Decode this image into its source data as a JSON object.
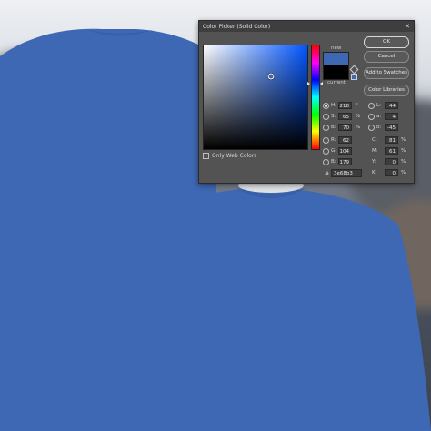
{
  "dialog": {
    "title": "Color Picker (Solid Color)",
    "close_glyph": "✕",
    "new_label": "new",
    "current_label": "current",
    "new_color": "#3e68b3",
    "current_color": "#000000",
    "hue_base_color": "#0055ff",
    "buttons": {
      "ok": "OK",
      "cancel": "Cancel",
      "add_to_swatches": "Add to Swatches",
      "color_libraries": "Color Libraries"
    },
    "only_web_colors": "Only Web Colors",
    "hex_prefix": "#",
    "hex_value": "3e68b3",
    "fields": {
      "H": {
        "label": "H:",
        "value": "218",
        "unit": "°"
      },
      "S": {
        "label": "S:",
        "value": "65",
        "unit": "%"
      },
      "B": {
        "label": "B:",
        "value": "70",
        "unit": "%"
      },
      "R": {
        "label": "R:",
        "value": "62",
        "unit": ""
      },
      "G": {
        "label": "G:",
        "value": "104",
        "unit": ""
      },
      "Bl": {
        "label": "B:",
        "value": "179",
        "unit": ""
      },
      "L": {
        "label": "L:",
        "value": "44",
        "unit": ""
      },
      "a": {
        "label": "a:",
        "value": "4",
        "unit": ""
      },
      "b": {
        "label": "b:",
        "value": "-45",
        "unit": ""
      },
      "C": {
        "label": "C:",
        "value": "81",
        "unit": "%"
      },
      "M": {
        "label": "M:",
        "value": "61",
        "unit": "%"
      },
      "Y": {
        "label": "Y:",
        "value": "0",
        "unit": "%"
      },
      "K": {
        "label": "K:",
        "value": "0",
        "unit": "%"
      }
    }
  },
  "sweater": {
    "color": "#3e68b3",
    "shade": "#3760a7"
  }
}
